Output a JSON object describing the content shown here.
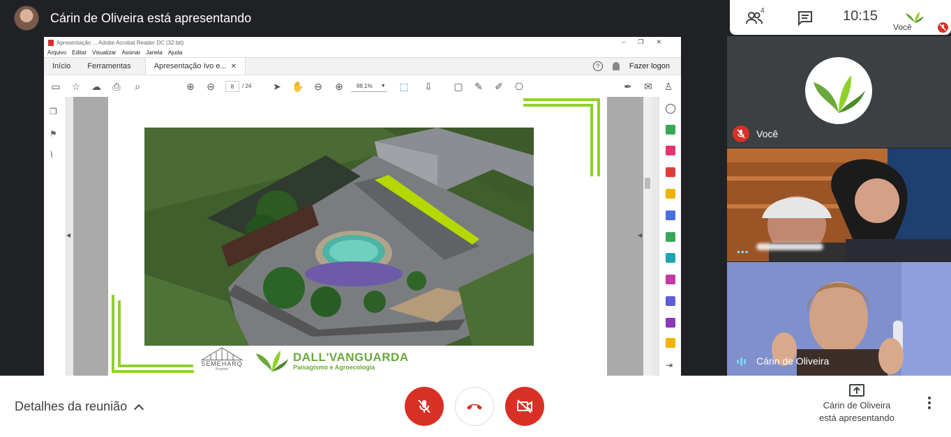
{
  "header": {
    "presenter_title": "Cárin de Oliveira está apresentando"
  },
  "top_panel": {
    "people_count": "4",
    "clock": "10:15",
    "self_label": "Você"
  },
  "acrobat": {
    "window_title": "Apresentação ... Adobe Acrobat Reader DC (32-bit)",
    "menu": [
      "Arquivo",
      "Editar",
      "Visualizar",
      "Assinar",
      "Janela",
      "Ajuda"
    ],
    "tabs": {
      "home": "Início",
      "tools": "Ferramentas",
      "document": "Apresentação Ivo e..."
    },
    "login": "Fazer logon",
    "page_current": "8",
    "page_total": "/ 24",
    "zoom": "88,1%"
  },
  "slide": {
    "logo_left_name": "SEMEHARQ",
    "logo_left_sub": "Projetos",
    "logo_right_name": "DALL'VANGUARDA",
    "logo_right_sub": "Paisagismo e Agroecologia"
  },
  "participants": {
    "you_label": "Você",
    "cam2_label": "Cárin de Oliveira"
  },
  "bottom": {
    "details_label": "Detalhes da reunião",
    "presenting_line1": "Cárin de Oliveira",
    "presenting_line2": "está apresentando"
  },
  "colors": {
    "danger": "#d93025",
    "accent_green": "#8fd12a",
    "brand_green": "#6aa83a"
  }
}
